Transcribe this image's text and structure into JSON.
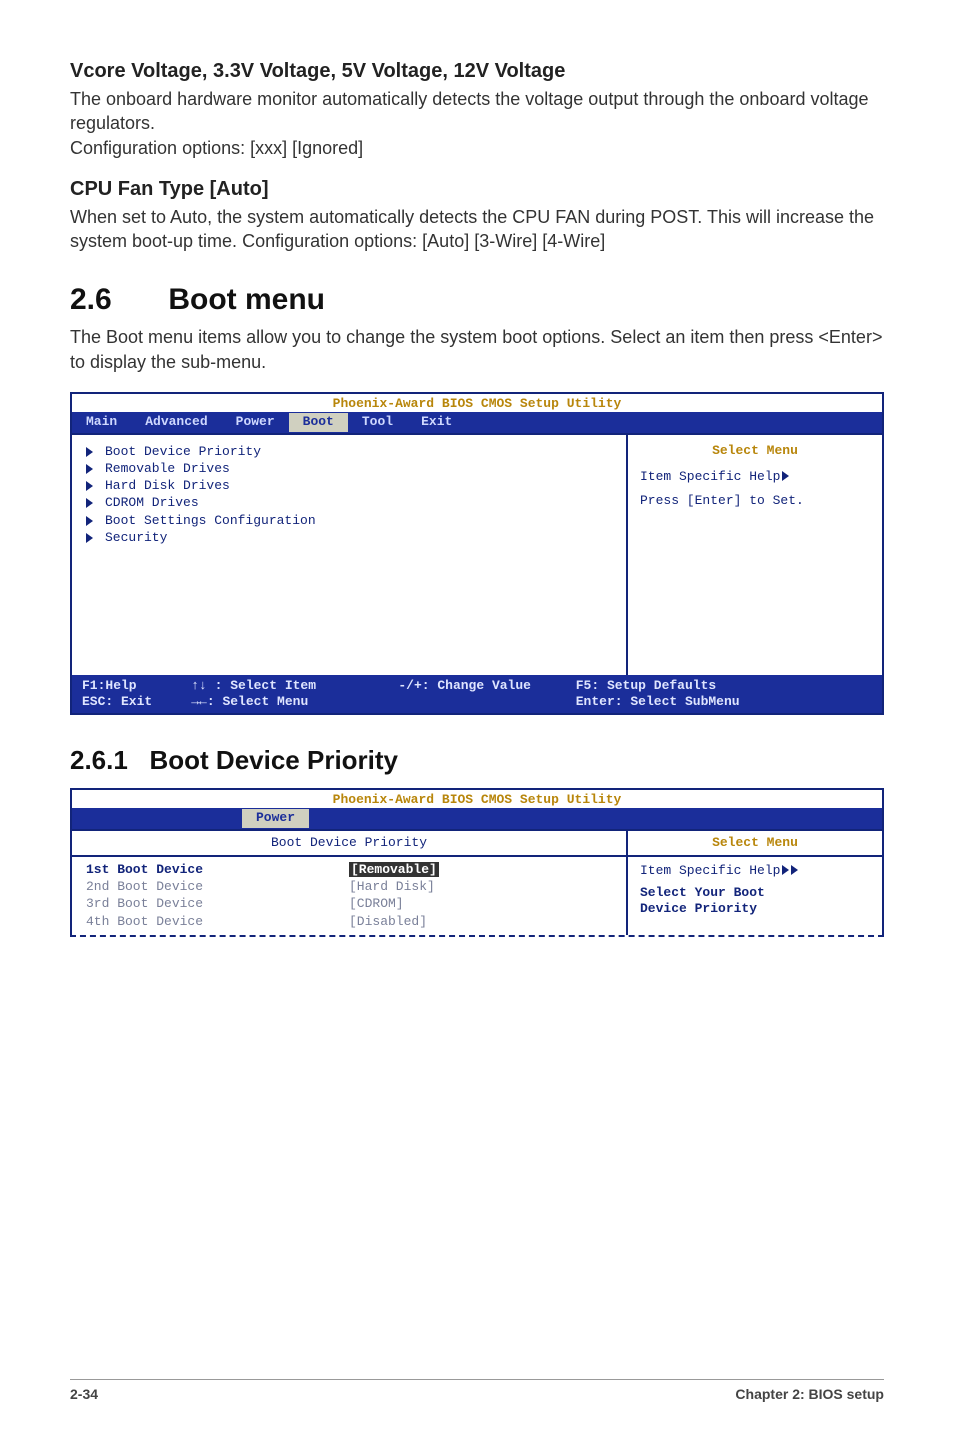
{
  "vcore": {
    "heading": "Vcore Voltage, 3.3V Voltage, 5V Voltage, 12V Voltage",
    "para": "The onboard hardware monitor automatically detects the voltage output through the onboard voltage regulators.",
    "opts": "Configuration options: [xxx] [Ignored]"
  },
  "cpufan": {
    "heading": "CPU Fan Type [Auto]",
    "para": "When set to Auto, the system automatically detects the CPU FAN during POST. This will increase the system boot-up time. Configuration options: [Auto] [3-Wire] [4-Wire]"
  },
  "section": {
    "num": "2.6",
    "title": "Boot menu",
    "intro": "The Boot menu items allow you to change the system boot options. Select an item then press <Enter> to display the sub-menu."
  },
  "bios1": {
    "title": "Phoenix-Award BIOS CMOS Setup Utility",
    "tabs": [
      "Main",
      "Advanced",
      "Power",
      "Boot",
      "Tool",
      "Exit"
    ],
    "active_tab": "Boot",
    "items": [
      "Boot Device Priority",
      "Removable Drives",
      "Hard Disk Drives",
      "CDROM Drives",
      "Boot Settings Configuration",
      "Security"
    ],
    "right": {
      "sel": "Select Menu",
      "help": "Item Specific Help",
      "hint": "Press [Enter] to Set."
    },
    "footer": {
      "l1": "F1:Help",
      "l2": "ESC: Exit",
      "m1": "↑↓ : Select Item",
      "m2": "→←: Select Menu",
      "c1": "-/+: Change Value",
      "r1": "F5: Setup Defaults",
      "r2": "Enter: Select SubMenu"
    }
  },
  "sub": {
    "num": "2.6.1",
    "title": "Boot Device Priority"
  },
  "bios2": {
    "title": "Phoenix-Award BIOS CMOS Setup Utility",
    "tab": "Power",
    "panel_title": "Boot Device Priority",
    "rows": [
      {
        "label": "1st Boot Device",
        "value": "[Removable]",
        "active": true
      },
      {
        "label": "2nd Boot Device",
        "value": "[Hard Disk]",
        "active": false
      },
      {
        "label": "3rd Boot Device",
        "value": "[CDROM]",
        "active": false
      },
      {
        "label": "4th Boot Device",
        "value": "[Disabled]",
        "active": false
      }
    ],
    "right": {
      "sel": "Select Menu",
      "help": "Item Specific Help",
      "hint1": "Select Your Boot",
      "hint2": "Device Priority"
    }
  },
  "footer": {
    "left": "2-34",
    "right": "Chapter 2: BIOS setup"
  }
}
